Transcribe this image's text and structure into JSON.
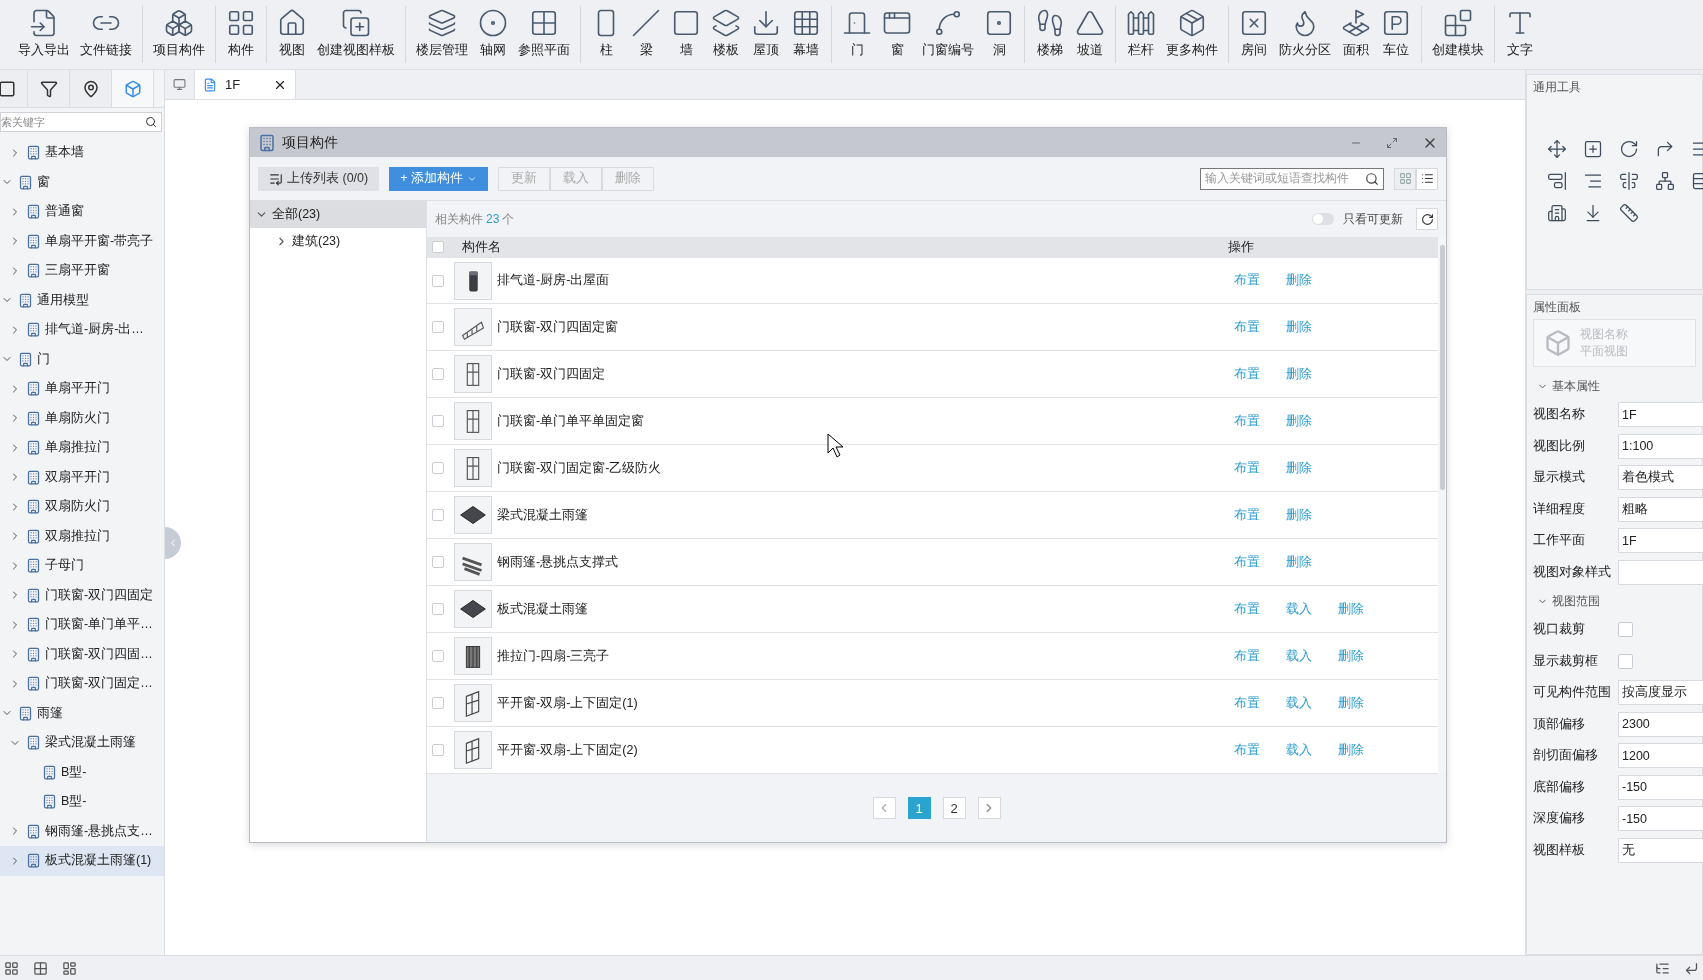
{
  "toolbar": {
    "groups": [
      {
        "buttons": [
          {
            "label": "导入导出"
          },
          {
            "label": "文件链接"
          }
        ]
      },
      {
        "buttons": [
          {
            "label": "项目构件"
          }
        ]
      },
      {
        "buttons": [
          {
            "label": "构件"
          }
        ]
      },
      {
        "buttons": [
          {
            "label": "视图"
          },
          {
            "label": "创建视图样板"
          }
        ]
      },
      {
        "buttons": [
          {
            "label": "楼层管理"
          },
          {
            "label": "轴网"
          },
          {
            "label": "参照平面"
          }
        ]
      },
      {
        "buttons": [
          {
            "label": "柱"
          },
          {
            "label": "梁"
          },
          {
            "label": "墙"
          },
          {
            "label": "楼板"
          },
          {
            "label": "屋顶"
          },
          {
            "label": "幕墙"
          }
        ]
      },
      {
        "buttons": [
          {
            "label": "门"
          },
          {
            "label": "窗"
          },
          {
            "label": "门窗编号"
          },
          {
            "label": "洞"
          }
        ]
      },
      {
        "buttons": [
          {
            "label": "楼梯"
          },
          {
            "label": "坡道"
          }
        ]
      },
      {
        "buttons": [
          {
            "label": "栏杆"
          },
          {
            "label": "更多构件"
          }
        ]
      },
      {
        "buttons": [
          {
            "label": "房间"
          },
          {
            "label": "防火分区"
          },
          {
            "label": "面积"
          },
          {
            "label": "车位"
          }
        ]
      },
      {
        "buttons": [
          {
            "label": "创建模块"
          }
        ]
      },
      {
        "buttons": [
          {
            "label": "文字"
          }
        ]
      }
    ]
  },
  "sidebar": {
    "tabs": [
      {
        "selected": false
      },
      {
        "selected": false
      },
      {
        "selected": false
      },
      {
        "selected": true
      }
    ],
    "search": {
      "placeholder": "索关键字"
    },
    "tree": [
      {
        "children": [
          {
            "label": "基本墙",
            "expanded": false,
            "selected": false
          }
        ]
      },
      {
        "label": "窗",
        "expanded": true,
        "selected": false,
        "children": [
          {
            "label": "普通窗",
            "expanded": false,
            "selected": false
          },
          {
            "label": "单扇平开窗-带亮子",
            "expanded": false,
            "selected": false
          },
          {
            "label": "三扇平开窗",
            "expanded": false,
            "selected": false
          }
        ]
      },
      {
        "label": "通用模型",
        "expanded": true,
        "selected": false,
        "children": [
          {
            "label": "排气道-厨房-出…",
            "expanded": false,
            "selected": false
          }
        ]
      },
      {
        "label": "门",
        "expanded": true,
        "selected": false,
        "children": [
          {
            "label": "单扇平开门",
            "expanded": false,
            "selected": false
          },
          {
            "label": "单扇防火门",
            "expanded": false,
            "selected": false
          },
          {
            "label": "单扇推拉门",
            "expanded": false,
            "selected": false
          },
          {
            "label": "双扇平开门",
            "expanded": false,
            "selected": false
          },
          {
            "label": "双扇防火门",
            "expanded": false,
            "selected": false
          },
          {
            "label": "双扇推拉门",
            "expanded": false,
            "selected": false
          },
          {
            "label": "子母门",
            "expanded": false,
            "selected": false
          },
          {
            "label": "门联窗-双门四固定",
            "expanded": false,
            "selected": false
          },
          {
            "label": "门联窗-单门单平…",
            "expanded": false,
            "selected": false
          },
          {
            "label": "门联窗-双门四固…",
            "expanded": false,
            "selected": false
          },
          {
            "label": "门联窗-双门固定…",
            "expanded": false,
            "selected": false
          }
        ]
      },
      {
        "label": "雨篷",
        "expanded": true,
        "selected": false,
        "children": [
          {
            "label": "梁式混凝土雨篷",
            "expanded": true,
            "selected": false,
            "children": [
              {
                "label": "B型-",
                "selected": false
              },
              {
                "label": "B型-",
                "selected": false
              }
            ]
          },
          {
            "label": "钢雨篷-悬挑点支…",
            "expanded": false,
            "selected": false
          },
          {
            "label": "板式混凝土雨篷(1)",
            "expanded": false,
            "selected": true
          }
        ]
      }
    ]
  },
  "view_tabs": [
    {
      "label": "1F",
      "selected": true
    }
  ],
  "dialog": {
    "title": "项目构件",
    "toolbar": {
      "upload": "上传列表 (0/0)",
      "add": "+ 添加构件",
      "actions": [
        {
          "label": "更新",
          "disabled": true
        },
        {
          "label": "载入",
          "disabled": true
        },
        {
          "label": "删除",
          "disabled": true
        }
      ],
      "search": {
        "placeholder": "输入关键词或短语查找构件"
      },
      "views": [
        {
          "selected": false
        },
        {
          "selected": true
        }
      ]
    },
    "tree": [
      {
        "label": "全部(23)",
        "expanded": true,
        "selected": true,
        "children": [
          {
            "label": "建筑(23)",
            "expanded": false,
            "selected": false
          }
        ]
      }
    ],
    "summary": {
      "label": "相关构件",
      "count": "23",
      "unit": "个"
    },
    "filter": {
      "label": "只看可更新",
      "on": false
    },
    "table": {
      "all_checked": false,
      "columns": [
        "构件名",
        "操作"
      ],
      "rows": [
        {
          "name": "排气道-厨房-出屋面",
          "checked": false,
          "actions": [
            "布置",
            "删除"
          ]
        },
        {
          "name": "门联窗-双门四固定窗",
          "checked": false,
          "actions": [
            "布置",
            "删除"
          ]
        },
        {
          "name": "门联窗-双门四固定",
          "checked": false,
          "actions": [
            "布置",
            "删除"
          ]
        },
        {
          "name": "门联窗-单门单平单固定窗",
          "checked": false,
          "actions": [
            "布置",
            "删除"
          ]
        },
        {
          "name": "门联窗-双门固定窗-乙级防火",
          "checked": false,
          "actions": [
            "布置",
            "删除"
          ]
        },
        {
          "name": "梁式混凝土雨篷",
          "checked": false,
          "actions": [
            "布置",
            "删除"
          ]
        },
        {
          "name": "钢雨篷-悬挑点支撑式",
          "checked": false,
          "actions": [
            "布置",
            "删除"
          ]
        },
        {
          "name": "板式混凝土雨篷",
          "checked": false,
          "actions": [
            "布置",
            "载入",
            "删除"
          ]
        },
        {
          "name": "推拉门-四扇-三亮子",
          "checked": false,
          "actions": [
            "布置",
            "载入",
            "删除"
          ]
        },
        {
          "name": "平开窗-双扇-上下固定(1)",
          "checked": false,
          "actions": [
            "布置",
            "载入",
            "删除"
          ]
        },
        {
          "name": "平开窗-双扇-上下固定(2)",
          "checked": false,
          "actions": [
            "布置",
            "载入",
            "删除"
          ]
        }
      ]
    },
    "pages": [
      {
        "label": "1",
        "selected": true
      },
      {
        "label": "2",
        "selected": false
      }
    ]
  },
  "tools_panel": {
    "title": "通用工具"
  },
  "properties": {
    "title": "属性面板",
    "preview": {
      "title": "视图名称",
      "subtitle": "平面视图"
    },
    "sections": [
      {
        "title": "基本属性",
        "expanded": true,
        "rows": [
          {
            "kind": "text",
            "label": "视图名称",
            "value": "1F"
          },
          {
            "kind": "text",
            "label": "视图比例",
            "value": "1:100"
          },
          {
            "kind": "text",
            "label": "显示模式",
            "value": "着色模式"
          },
          {
            "kind": "text",
            "label": "详细程度",
            "value": "粗略"
          },
          {
            "kind": "text",
            "label": "工作平面",
            "value": "1F"
          },
          {
            "kind": "text",
            "label": "视图对象样式"
          }
        ]
      },
      {
        "title": "视图范围",
        "expanded": true,
        "rows": [
          {
            "kind": "check",
            "label": "视口裁剪",
            "checked": false
          },
          {
            "kind": "check",
            "label": "显示裁剪框",
            "checked": false
          },
          {
            "kind": "text",
            "label": "可见构件范围",
            "value": "按高度显示"
          },
          {
            "kind": "text",
            "label": "顶部偏移",
            "value": "2300"
          },
          {
            "kind": "text",
            "label": "剖切面偏移",
            "value": "1200"
          },
          {
            "kind": "text",
            "label": "底部偏移",
            "value": "-150"
          },
          {
            "kind": "text",
            "label": "深度偏移",
            "value": "-150"
          },
          {
            "kind": "text",
            "label": "视图样板",
            "value": "无"
          }
        ]
      }
    ]
  }
}
